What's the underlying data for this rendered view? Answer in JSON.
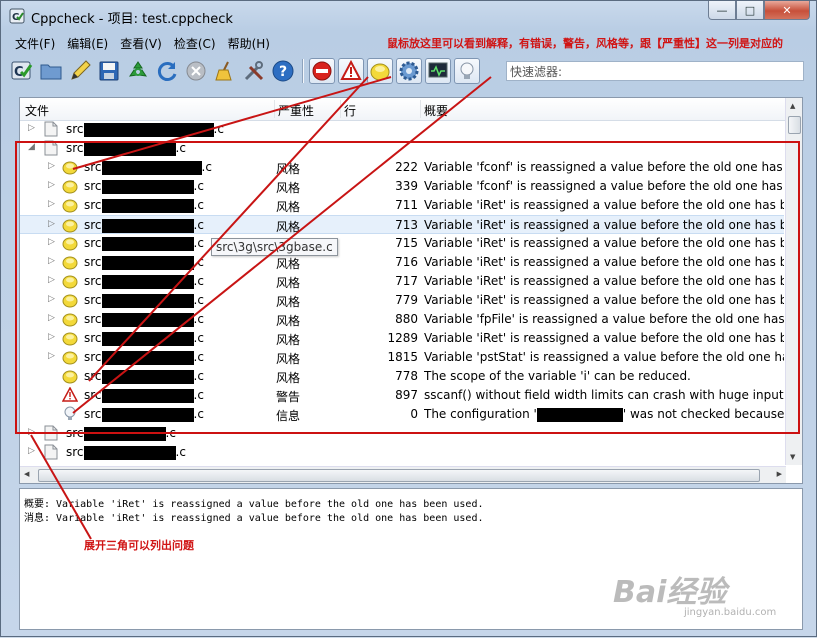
{
  "window": {
    "title": "Cppcheck - 项目: test.cppcheck",
    "buttons": [
      "—",
      "□",
      "✕"
    ]
  },
  "menu": [
    "文件(F)",
    "编辑(E)",
    "查看(V)",
    "检查(C)",
    "帮助(H)"
  ],
  "annotations": {
    "top": "鼠标放这里可以看到解释，有错误，警告，风格等，跟【严重性】这一列是对应的",
    "bottom": "展开三角可以列出问题"
  },
  "filter": {
    "placeholder": "快速滤器:"
  },
  "columns": [
    "文件",
    "严重性",
    "行",
    "概要"
  ],
  "rows": [
    {
      "indent": 0,
      "arrow": "▷",
      "icon": "file-icon",
      "prefix": "src",
      "redact_w": 130,
      "suffix": ".c",
      "severity": "",
      "line": "",
      "summary": ""
    },
    {
      "indent": 0,
      "arrow": "◢",
      "icon": "file-icon",
      "prefix": "src",
      "redact_w": 92,
      "suffix": ".c",
      "severity": "",
      "line": "",
      "summary": ""
    },
    {
      "indent": 1,
      "arrow": "▷",
      "icon": "style-icon",
      "prefix": "src",
      "redact_w": 100,
      "suffix": ".c",
      "severity": "风格",
      "line": "222",
      "summary": "Variable 'fconf' is reassigned a value before the old one has b"
    },
    {
      "indent": 1,
      "arrow": "▷",
      "icon": "style-icon",
      "prefix": "src",
      "redact_w": 92,
      "suffix": ".c",
      "severity": "风格",
      "line": "339",
      "summary": "Variable 'fconf' is reassigned a value before the old one has b"
    },
    {
      "indent": 1,
      "arrow": "▷",
      "icon": "style-icon",
      "prefix": "src",
      "redact_w": 92,
      "suffix": ".c",
      "severity": "风格",
      "line": "711",
      "summary": "Variable 'iRet' is reassigned a value before the old one has be"
    },
    {
      "indent": 1,
      "arrow": "▷",
      "icon": "style-icon",
      "prefix": "src",
      "redact_w": 92,
      "suffix": ".c",
      "severity": "风格",
      "line": "713",
      "summary": "Variable 'iRet' is reassigned a value before the old one has be",
      "selected": true
    },
    {
      "indent": 1,
      "arrow": "▷",
      "icon": "style-icon",
      "prefix": "src",
      "redact_w": 92,
      "suffix": ".c",
      "severity": "风格",
      "line": "715",
      "summary": "Variable 'iRet' is reassigned a value before the old one has be"
    },
    {
      "indent": 1,
      "arrow": "▷",
      "icon": "style-icon",
      "prefix": "src",
      "redact_w": 92,
      "suffix": ".c",
      "severity": "风格",
      "line": "716",
      "summary": "Variable 'iRet' is reassigned a value before the old one has be"
    },
    {
      "indent": 1,
      "arrow": "▷",
      "icon": "style-icon",
      "prefix": "src",
      "redact_w": 92,
      "suffix": ".c",
      "severity": "风格",
      "line": "717",
      "summary": "Variable 'iRet' is reassigned a value before the old one has be"
    },
    {
      "indent": 1,
      "arrow": "▷",
      "icon": "style-icon",
      "prefix": "src",
      "redact_w": 92,
      "suffix": ".c",
      "severity": "风格",
      "line": "779",
      "summary": "Variable 'iRet' is reassigned a value before the old one has be"
    },
    {
      "indent": 1,
      "arrow": "▷",
      "icon": "style-icon",
      "prefix": "src",
      "redact_w": 92,
      "suffix": ".c",
      "severity": "风格",
      "line": "880",
      "summary": "Variable 'fpFile' is reassigned a value before the old one has ."
    },
    {
      "indent": 1,
      "arrow": "▷",
      "icon": "style-icon",
      "prefix": "src",
      "redact_w": 92,
      "suffix": ".c",
      "severity": "风格",
      "line": "1289",
      "summary": "Variable 'iRet' is reassigned a value before the old one has be"
    },
    {
      "indent": 1,
      "arrow": "▷",
      "icon": "style-icon",
      "prefix": "src",
      "redact_w": 92,
      "suffix": ".c",
      "severity": "风格",
      "line": "1815",
      "summary": "Variable 'pstStat' is reassigned a value before the old one has"
    },
    {
      "indent": 1,
      "arrow": "",
      "icon": "style-icon",
      "prefix": "src",
      "redact_w": 92,
      "suffix": ".c",
      "severity": "风格",
      "line": "778",
      "summary": "The scope of the variable 'i' can be reduced."
    },
    {
      "indent": 1,
      "arrow": "",
      "icon": "warning-icon",
      "prefix": "src",
      "redact_w": 92,
      "suffix": ".c",
      "severity": "警告",
      "line": "897",
      "summary": "sscanf() without field width limits can crash with huge input dat"
    },
    {
      "indent": 1,
      "arrow": "",
      "icon": "info-icon",
      "prefix": "src",
      "redact_w": 92,
      "suffix": ".c",
      "severity": "信息",
      "line": "0",
      "summary": "The configuration '",
      "summary_redact_w": 86,
      "summary_tail": "' was not checked because it."
    },
    {
      "indent": 0,
      "arrow": "▷",
      "icon": "file-icon",
      "prefix": "src",
      "redact_w": 82,
      "suffix": ".c",
      "severity": "",
      "line": "",
      "summary": ""
    },
    {
      "indent": 0,
      "arrow": "▷",
      "icon": "file-icon",
      "prefix": "src",
      "redact_w": 92,
      "suffix": ".c",
      "severity": "",
      "line": "",
      "summary": ""
    }
  ],
  "tooltip": "src\\3g\\src\\3gbase.c",
  "details": {
    "summary": "概要: Variable 'iRet' is reassigned a value before the old one has been used.",
    "message": "消息: Variable 'iRet' is reassigned a value before the old one has been used."
  },
  "watermark": {
    "logo": "Bai经验",
    "url": "jingyan.baidu.com"
  }
}
